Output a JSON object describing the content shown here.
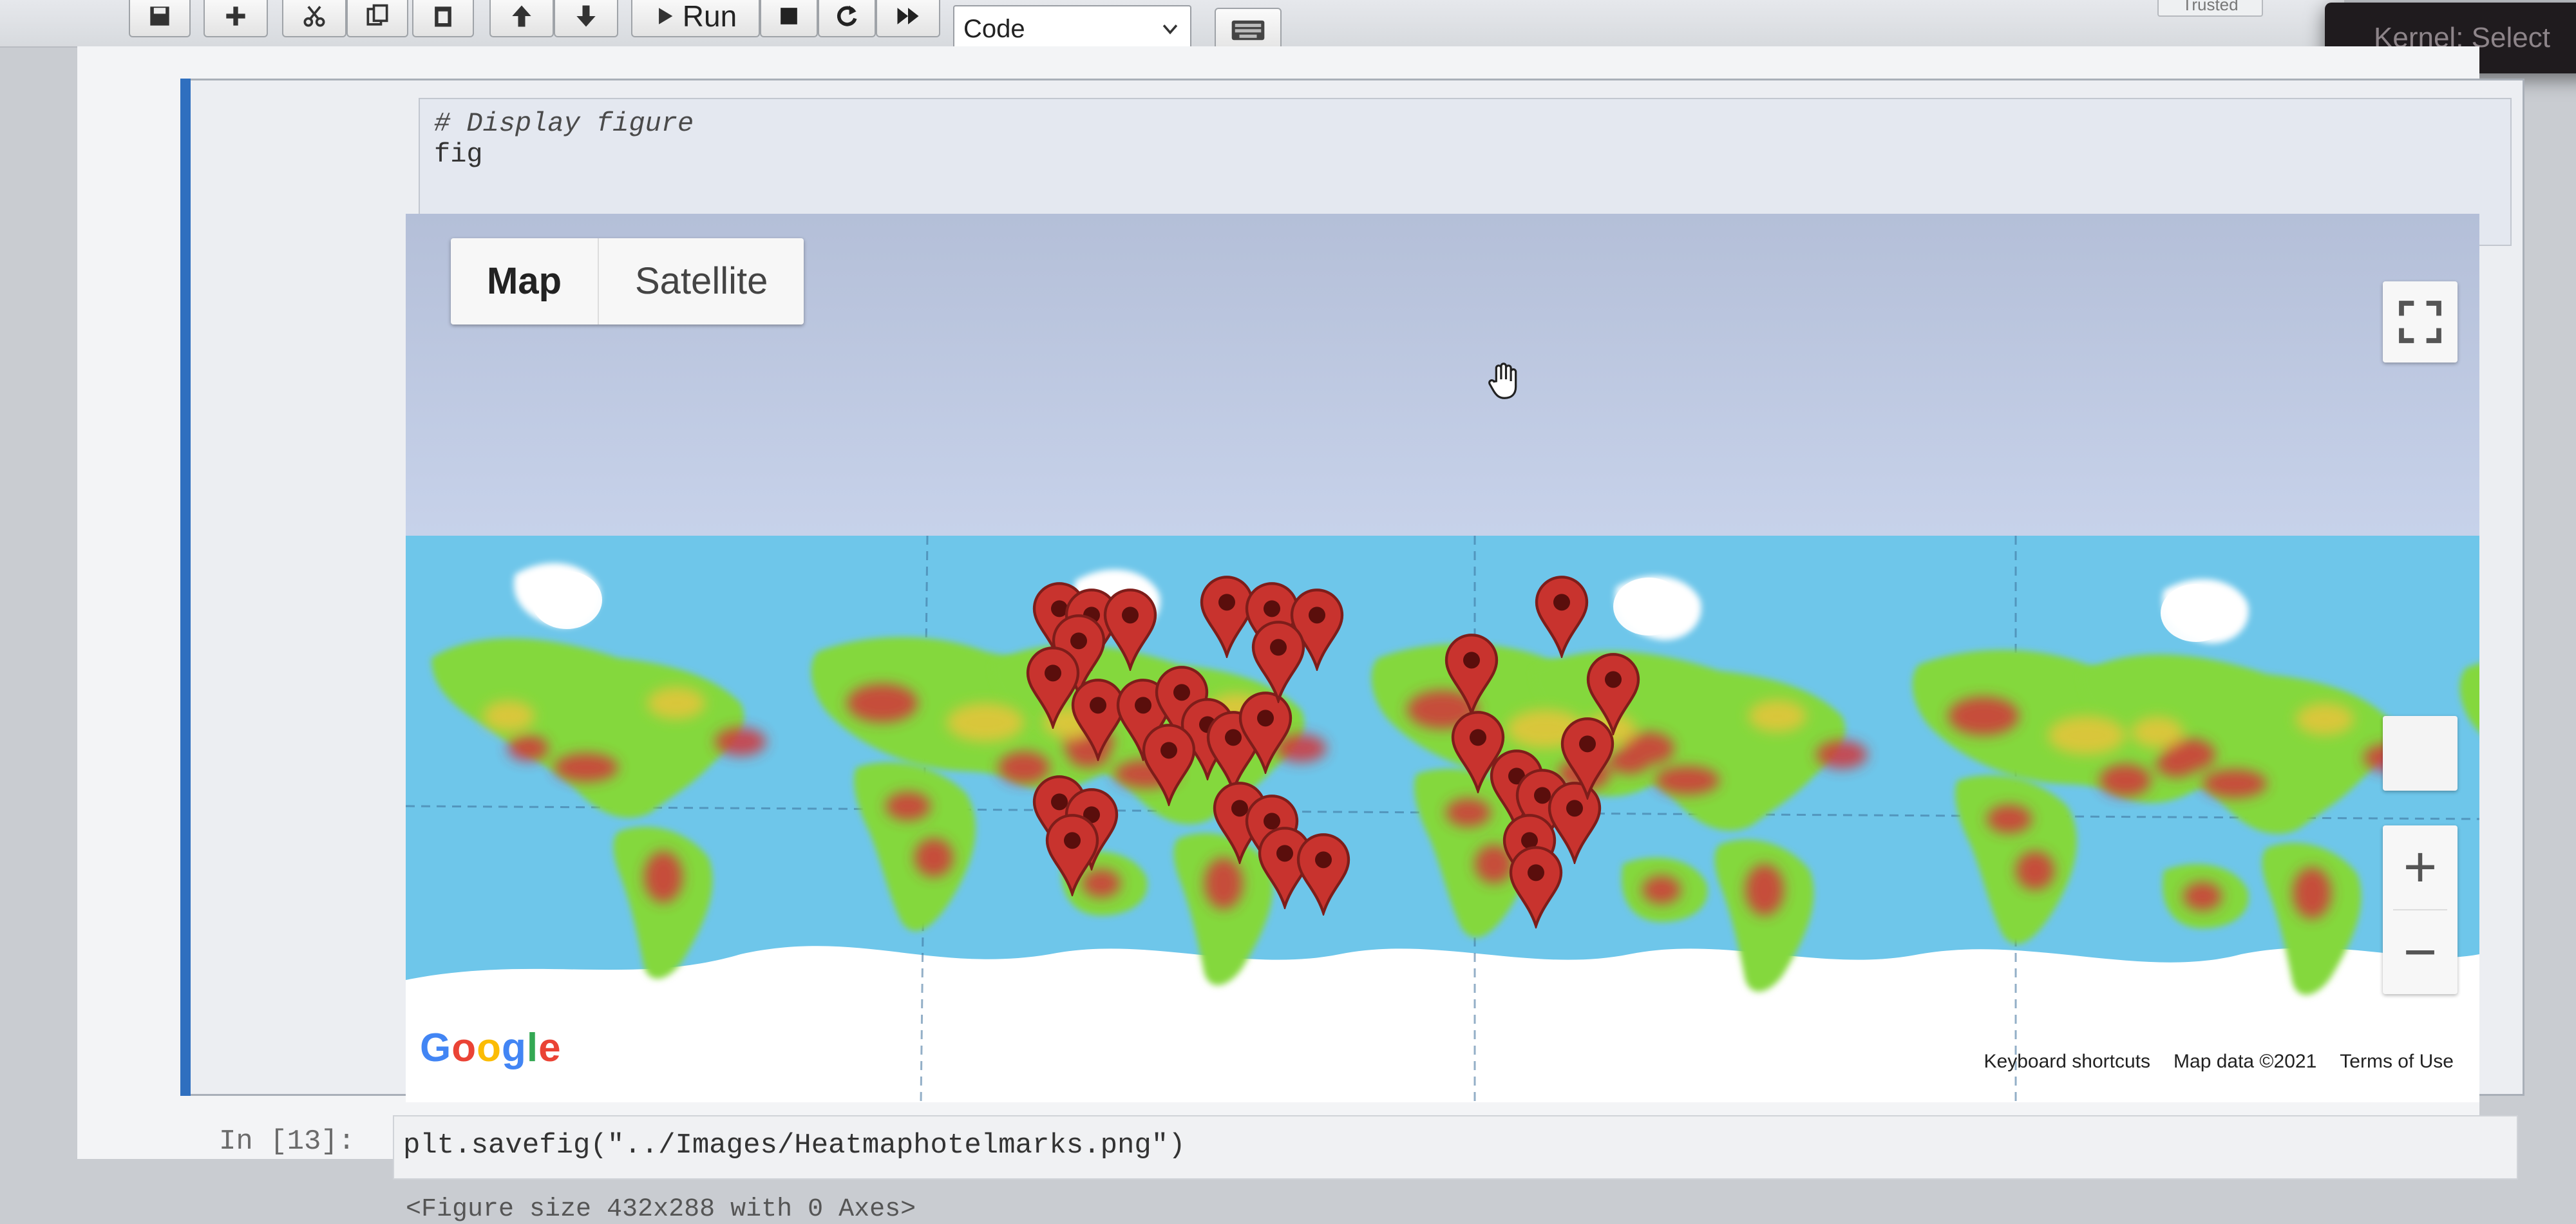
{
  "toolbar": {
    "run_label": "Run",
    "cell_type": "Code",
    "trusted_label": "Trusted",
    "kernel_tooltip": "Kernel: Select"
  },
  "cell": {
    "code_lines": [
      "# Display figure",
      "fig"
    ]
  },
  "map": {
    "map_button": "Map",
    "satellite_button": "Satellite",
    "zoom_in": "+",
    "zoom_out": "−",
    "google_logo": "Google",
    "attribution": {
      "shortcuts": "Keyboard shortcuts",
      "map_data": "Map data ©2021",
      "terms": "Terms of Use"
    },
    "colors": {
      "ocean": "#6ec6ea",
      "land_low": "#7fd83a",
      "land_high": "#e8c43a",
      "heat": "#d2343a",
      "marker": "#c8332e",
      "ice": "#ffffff"
    }
  },
  "next_cell": {
    "prompt": "In [13]:",
    "code": "plt.savefig(\"../Images/Heatmaphotelmarks.png\")",
    "output_partial": "<Figure size 432x288 with 0 Axes>"
  }
}
